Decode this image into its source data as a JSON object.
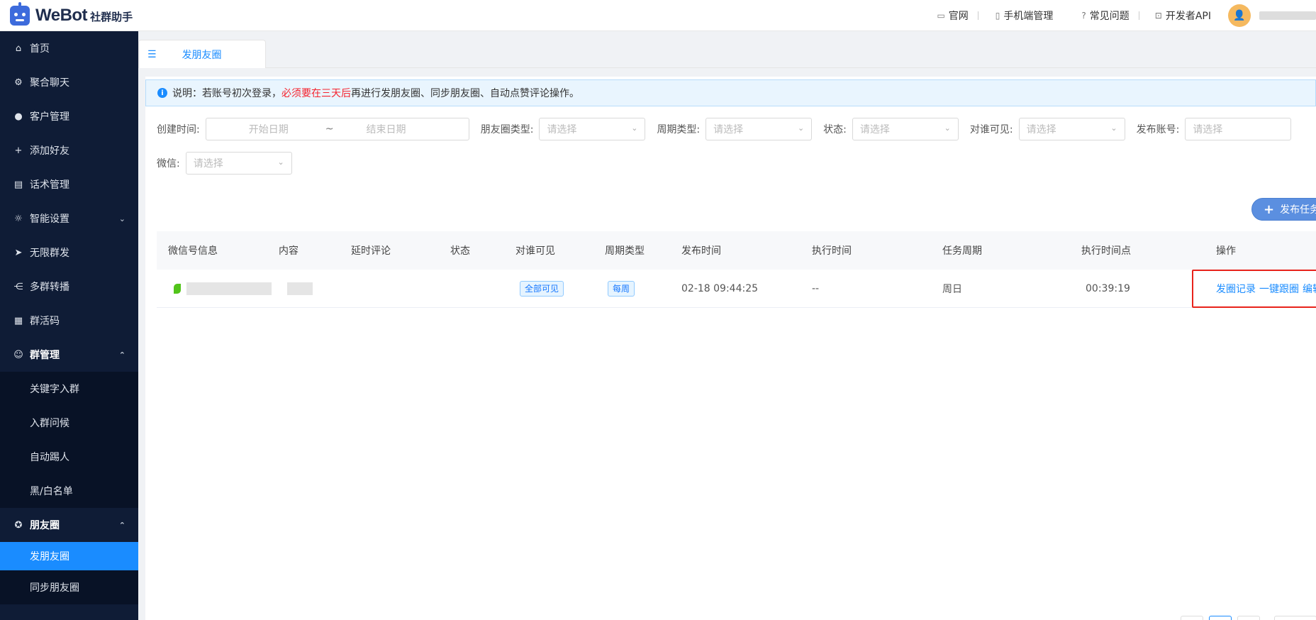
{
  "header": {
    "logo_text": "WeBot",
    "logo_sub": "社群助手",
    "links": [
      {
        "icon": "monitor-icon",
        "glyph": "▭",
        "label": "官网"
      },
      {
        "icon": "phone-icon",
        "glyph": "▯",
        "label": "手机端管理"
      },
      {
        "icon": "help-icon",
        "glyph": "?",
        "label": "常见问题"
      },
      {
        "icon": "api-icon",
        "glyph": "⊡",
        "label": "开发者API"
      }
    ],
    "avatar_glyph": "👤"
  },
  "sidebar": {
    "items": [
      {
        "label": "首页",
        "glyph": "⌂"
      },
      {
        "label": "聚合聊天",
        "glyph": "⚙"
      },
      {
        "label": "客户管理",
        "glyph": "●"
      },
      {
        "label": "添加好友",
        "glyph": "+"
      },
      {
        "label": "话术管理",
        "glyph": "▤"
      },
      {
        "label": "智能设置",
        "glyph": "☼"
      },
      {
        "label": "无限群发",
        "glyph": "➤"
      },
      {
        "label": "多群转播",
        "glyph": "⋲"
      },
      {
        "label": "群活码",
        "glyph": "▦"
      }
    ],
    "group_manage": {
      "label": "群管理",
      "glyph": "☺",
      "children": [
        "关键字入群",
        "入群问候",
        "自动踢人",
        "黑/白名单"
      ]
    },
    "moments": {
      "label": "朋友圈",
      "glyph": "✪",
      "children": [
        "发朋友圈",
        "同步朋友圈"
      ]
    }
  },
  "tabs": {
    "active": "发朋友圈",
    "collapse_glyph": "☰"
  },
  "notice": {
    "prefix": "说明：若账号初次登录，",
    "highlight": "必须要在三天后",
    "suffix": "再进行发朋友圈、同步朋友圈、自动点赞评论操作。"
  },
  "filters": {
    "created_label": "创建时间:",
    "start_placeholder": "开始日期",
    "range_sep": "~",
    "end_placeholder": "结束日期",
    "moment_type_label": "朋友圈类型:",
    "cycle_type_label": "周期类型:",
    "status_label": "状态:",
    "visible_label": "对谁可见:",
    "account_label": "发布账号:",
    "wechat_label": "微信:",
    "select_placeholder": "请选择"
  },
  "publish_button": "发布任务",
  "table": {
    "columns": [
      "微信号信息",
      "内容",
      "延时评论",
      "状态",
      "对谁可见",
      "周期类型",
      "发布时间",
      "执行时间",
      "任务周期",
      "执行时间点",
      "操作"
    ],
    "rows": [
      {
        "visible": "全部可见",
        "cycle_type": "每周",
        "publish_time": "02-18 09:44:25",
        "exec_time": "--",
        "task_cycle": "周日",
        "exec_point": "00:39:19",
        "actions": [
          "发圈记录",
          "一键跟圈",
          "编辑"
        ]
      }
    ]
  }
}
